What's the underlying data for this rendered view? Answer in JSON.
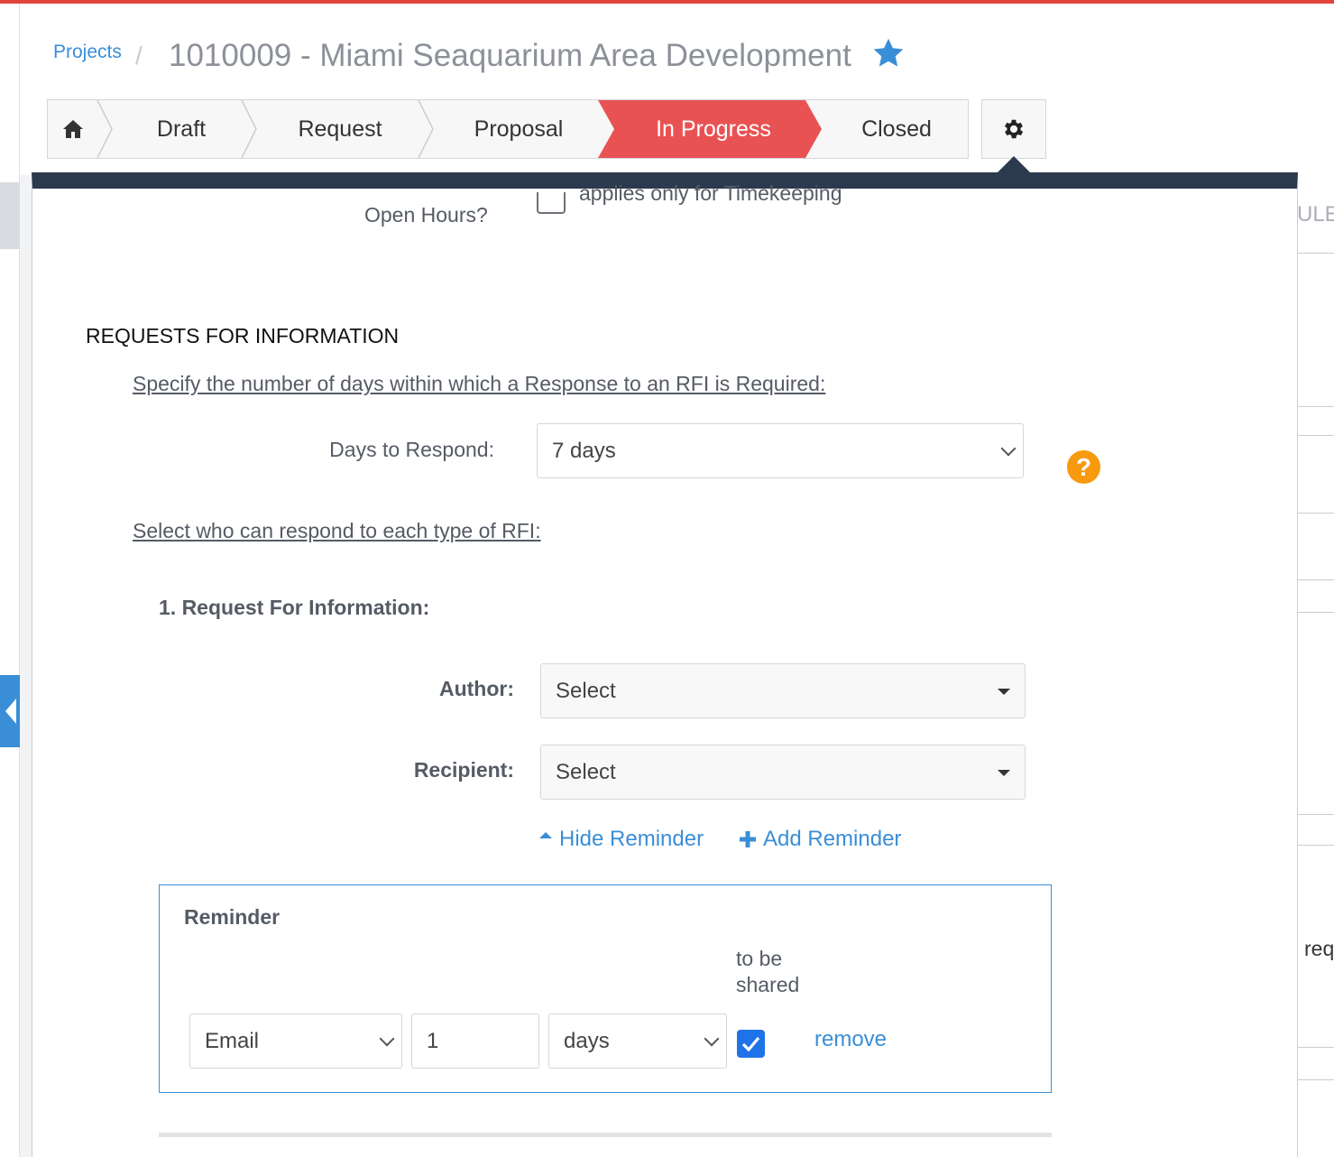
{
  "breadcrumb": {
    "projects_label": "Projects",
    "separator": "/",
    "title": "1010009 - Miami Seaquarium Area Development"
  },
  "steps": [
    {
      "label": "Draft"
    },
    {
      "label": "Request"
    },
    {
      "label": "Proposal"
    },
    {
      "label": "In Progress"
    },
    {
      "label": "Closed"
    }
  ],
  "right_side": {
    "header_fragment": "ULE",
    "text_fragment": "req"
  },
  "settings": {
    "open_hours_label": "Open Hours?",
    "applies_text": "applies only for Timekeeping",
    "section_title": "REQUESTS FOR INFORMATION",
    "days_instruction": "Specify the number of days within which a Response to an RFI is Required:",
    "days_label": "Days to Respond:",
    "days_value": "7 days",
    "help_glyph": "?",
    "respond_instruction": "Select who can respond to each type of RFI:",
    "rfi_type_title": "1. Request For Information:",
    "author_label": "Author:",
    "author_value": "Select",
    "recipient_label": "Recipient:",
    "recipient_value": "Select",
    "hide_reminder": "Hide Reminder",
    "add_reminder": "Add Reminder"
  },
  "reminder": {
    "title": "Reminder",
    "shared_line1": "to be",
    "shared_line2": "shared",
    "method_value": "Email",
    "amount_value": "1",
    "unit_value": "days",
    "shared_checked": true,
    "remove_label": "remove"
  },
  "colors": {
    "accent": "#3a8ed6",
    "active_step": "#e95253",
    "panel_header": "#2b3a4e",
    "help": "#f79a0e",
    "checkbox": "#1e73e8"
  }
}
